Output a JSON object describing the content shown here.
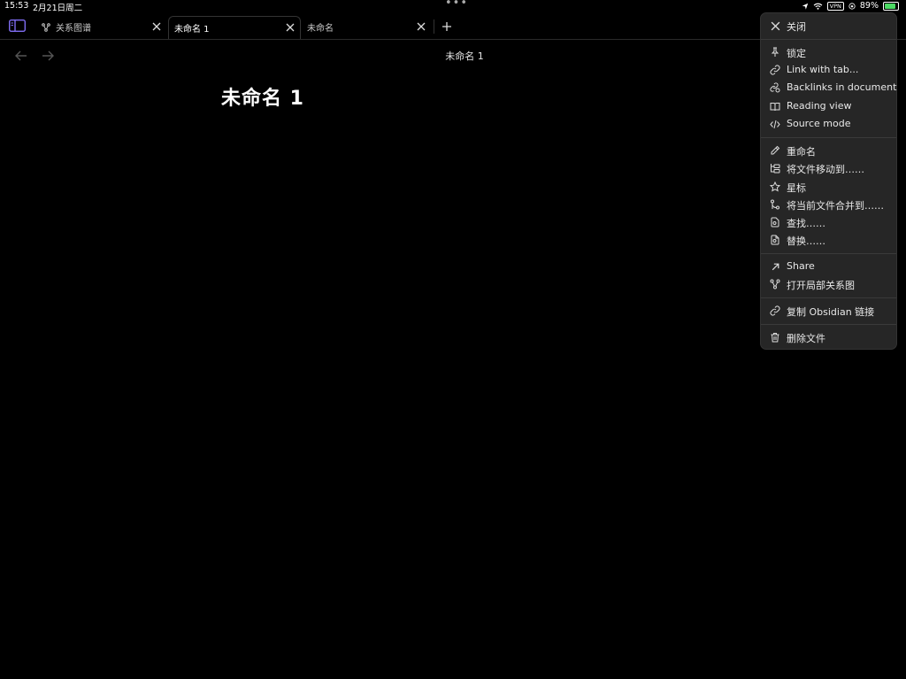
{
  "status_bar": {
    "time": "15:53",
    "date": "2月21日周二",
    "dots": "•••",
    "vpn": "VPN",
    "battery": "89%"
  },
  "tabs": [
    {
      "label": "关系图谱",
      "icon": "graph-icon",
      "active": false
    },
    {
      "label": "未命名 1",
      "active": true
    },
    {
      "label": "未命名",
      "active": false
    }
  ],
  "view_header": {
    "title": "未命名 1"
  },
  "note": {
    "title": "未命名 1"
  },
  "menu": {
    "close": "关闭",
    "pin": "锁定",
    "link_with_tab": "Link with tab...",
    "backlinks": "Backlinks in document",
    "reading_view": "Reading view",
    "source_mode": "Source mode",
    "rename": "重命名",
    "move_file": "将文件移动到……",
    "bookmark": "星标",
    "merge_file": "将当前文件合并到……",
    "find": "查找……",
    "replace": "替换……",
    "share": "Share",
    "local_graph": "打开局部关系图",
    "copy_link": "复制 Obsidian 链接",
    "delete_file": "删除文件"
  },
  "colors": {
    "accent": "#7f6df2",
    "background": "#000000",
    "menu_bg": "#262626",
    "battery": "#4cd964"
  }
}
